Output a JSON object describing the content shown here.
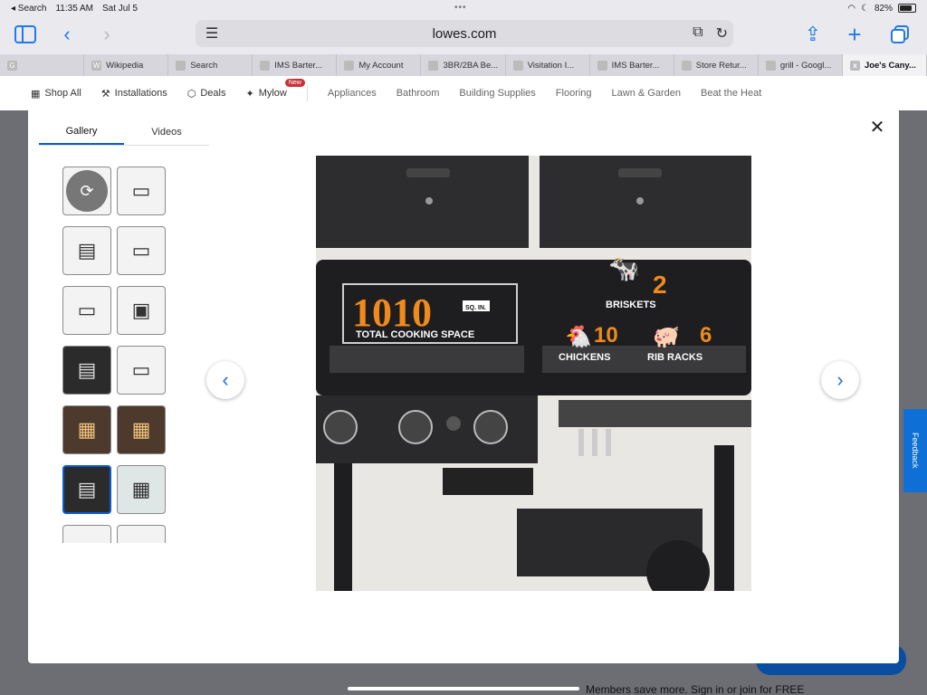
{
  "status": {
    "back_app": "◂ Search",
    "time": "11:35 AM",
    "date": "Sat Jul 5",
    "battery": "82%",
    "battery_level": 0.82
  },
  "browser": {
    "url": "lowes.com",
    "tabs": [
      {
        "label": "",
        "icon": "G"
      },
      {
        "label": "Wikipedia",
        "icon": "W"
      },
      {
        "label": "Search",
        "icon": ""
      },
      {
        "label": "IMS Barter...",
        "icon": ""
      },
      {
        "label": "My Account",
        "icon": ""
      },
      {
        "label": "3BR/2BA Be...",
        "icon": ""
      },
      {
        "label": "Visitation I...",
        "icon": ""
      },
      {
        "label": "IMS Barter...",
        "icon": ""
      },
      {
        "label": "Store Retur...",
        "icon": ""
      },
      {
        "label": "grill - Googl...",
        "icon": ""
      },
      {
        "label": "Joe's Cany...",
        "icon": "x"
      }
    ]
  },
  "nav": {
    "shop_all": "Shop All",
    "installations": "Installations",
    "deals": "Deals",
    "mylowe": "Mylow",
    "new_badge": "New",
    "appliances": "Appliances",
    "bathroom": "Bathroom",
    "building_supplies": "Building Supplies",
    "flooring": "Flooring",
    "lawn_garden": "Lawn & Garden",
    "beat_heat": "Beat the Heat"
  },
  "modal": {
    "tab_gallery": "Gallery",
    "tab_videos": "Videos",
    "close": "✕"
  },
  "image_text": {
    "big_number": "1010",
    "unit": "SQ. IN.",
    "caption": "TOTAL COOKING SPACE",
    "briskets_num": "2",
    "briskets": "BRISKETS",
    "chickens_num": "10",
    "chickens": "CHICKENS",
    "ribs_num": "6",
    "ribs": "RIB RACKS"
  },
  "background": {
    "footer_text": "Members save more. Sign in or join for FREE",
    "feedback": "Feedback"
  },
  "colors": {
    "accent": "#1f7aea",
    "orange": "#f08a1c"
  }
}
